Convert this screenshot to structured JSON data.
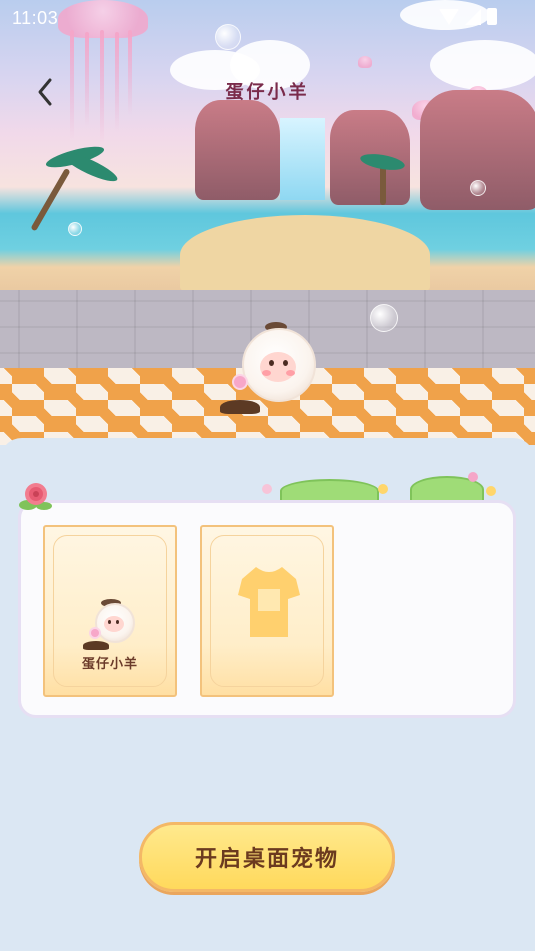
{
  "status_bar": {
    "time": "11:03"
  },
  "header": {
    "title": "蛋仔小羊",
    "back_icon": "chevron-left-icon"
  },
  "items": [
    {
      "label": "蛋仔小羊",
      "icon": "pet-sheep-icon"
    },
    {
      "label": "",
      "icon": "tshirt-icon"
    }
  ],
  "action": {
    "label": "开启桌面宠物"
  },
  "colors": {
    "title": "#7a2b4b",
    "button_fill": "#ffd95c",
    "button_border": "#f4b866",
    "card_border": "#f3c27c",
    "panel_bg": "#dbe7f3"
  }
}
